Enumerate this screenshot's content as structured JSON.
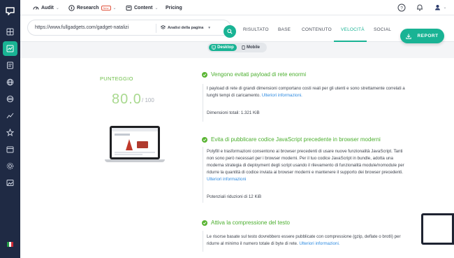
{
  "topbar": {
    "items": [
      {
        "label": "Audit",
        "icon": "gauge-icon",
        "chevron": true
      },
      {
        "label": "Research",
        "badge": "New",
        "icon": "compass-icon",
        "chevron": true
      },
      {
        "label": "Content",
        "icon": "content-icon",
        "chevron": true
      },
      {
        "label": "Pricing"
      }
    ]
  },
  "search": {
    "url": "https://www.fullgadgets.com/gadget-natalizi",
    "analysis_type": "Analisi della pagina"
  },
  "tabs": [
    {
      "label": "RISULTATO",
      "active": false
    },
    {
      "label": "BASE",
      "active": false
    },
    {
      "label": "CONTENUTO",
      "active": false
    },
    {
      "label": "VELOCITÀ",
      "active": true
    },
    {
      "label": "SOCIAL",
      "active": false
    }
  ],
  "report_button": "REPORT",
  "device_toggle": {
    "desktop": "Desktop",
    "mobile": "Mobile",
    "selected": "Desktop"
  },
  "score": {
    "label": "PUNTEGGIO",
    "value": "80.0",
    "max": "/ 100"
  },
  "audits": [
    {
      "title": "Vengono evitati payload di rete enormi",
      "text": "I payload di rete di grandi dimensioni comportano costi reali per gli utenti e sono strettamente correlati a lunghi tempi di caricamento.",
      "link": "Ulteriori informazioni.",
      "meta": "Dimensioni totali: 1.321 KiB"
    },
    {
      "title": "Evita di pubblicare codice JavaScript precedente in browser moderni",
      "text": "Polyfill e trasformazioni consentono ai browser precedenti di usare nuove funzionalità JavaScript. Tanti non sono però necessari per i browser moderni. Per il tuo codice JavaScript in bundle, adotta una moderna strategia di deployment degli script usando il rilevamento di funzionalità module/nomodule per ridurre la quantità di codice inviata ai browser moderni e mantenere il supporto dei browser precedenti.",
      "link": "Ulteriori informazioni",
      "meta": "Potenziali riduzioni di 12 KiB"
    },
    {
      "title": "Attiva la compressione del testo",
      "text": "Le risorse basate sul testo dovrebbero essere pubblicate con compressione (gzip, deflate o brotli) per ridurre al minimo il numero totale di byte di rete.",
      "link": "Ulteriori informazioni."
    }
  ],
  "colors": {
    "accent": "#19b394",
    "pass": "#5ab534",
    "link": "#2d8ae0",
    "sidebar": "#1f2a44"
  }
}
